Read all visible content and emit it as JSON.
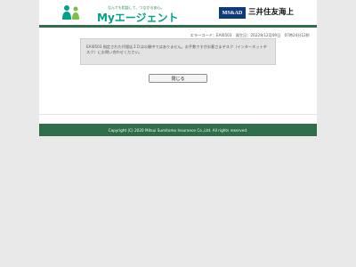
{
  "header": {
    "tagline": "なんでも相談して、つながる安心。",
    "brand_name": "Myエージェント",
    "partner_badge": "MS&AD",
    "partner_name": "三井住友海上"
  },
  "error": {
    "code_line": "エラーコード：EAI0503　発生日：2022年12月09日　07時24分12秒",
    "message": "EAI0503 指定された代理店ＩＤは公開中ではありません。お手数ですがお客さまデスク（インターネットデスク）にお問い合わせください。"
  },
  "actions": {
    "close_label": "閉じる"
  },
  "footer": {
    "copyright": "Copyright (C) 2020 Mitsui Sumitomo Insurance Co.,Ltd. All rights reserved."
  },
  "colors": {
    "brand_green": "#2f6e4a",
    "brand_teal": "#00a08a",
    "ms_blue": "#0e3a7b",
    "page_background": "#e9e9e9"
  }
}
